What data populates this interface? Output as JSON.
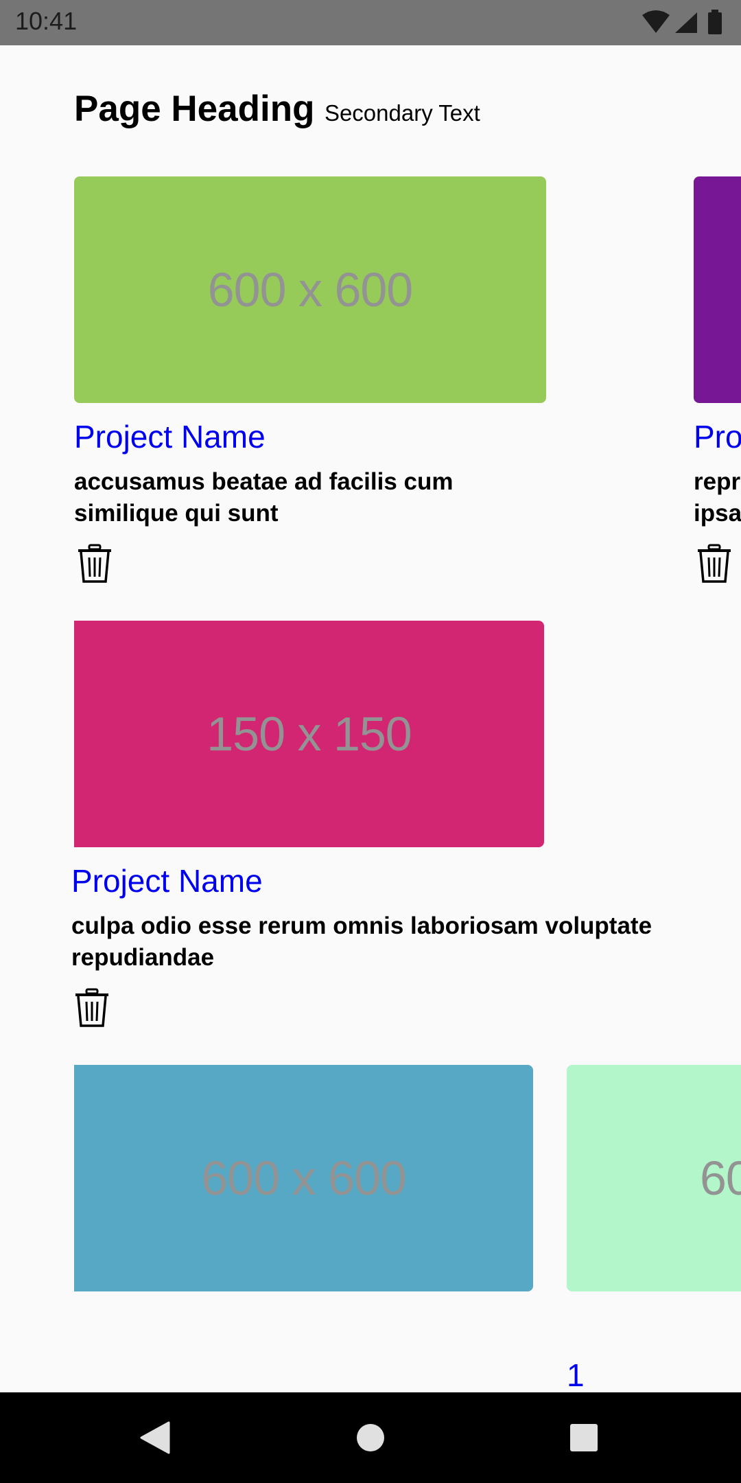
{
  "status_bar": {
    "time": "10:41"
  },
  "header": {
    "title": "Page Heading",
    "subtitle": "Secondary Text"
  },
  "cards": [
    {
      "thumb_label": "600 x 600",
      "thumb_color": "#96cb59",
      "name": "Project Name",
      "description": "accusamus beatae ad facilis cum similique qui sunt"
    },
    {
      "thumb_label": "",
      "thumb_color": "#771796",
      "name": "Pro",
      "description": "repr ipsa"
    },
    {
      "thumb_label": "150 x 150",
      "thumb_color": "#d22673",
      "name": "Project Name",
      "description": "culpa odio esse rerum omnis laboriosam voluptate repudiandae"
    },
    {
      "thumb_label": "600 x 600",
      "thumb_color": "#56a8c4",
      "name": "",
      "description": ""
    },
    {
      "thumb_label": "60",
      "thumb_color": "#b2f6ca",
      "name": "1",
      "description": ""
    }
  ],
  "icons": {
    "delete": "trash-icon",
    "nav_back": "back-triangle-icon",
    "nav_home": "home-circle-icon",
    "nav_recents": "recents-square-icon"
  }
}
